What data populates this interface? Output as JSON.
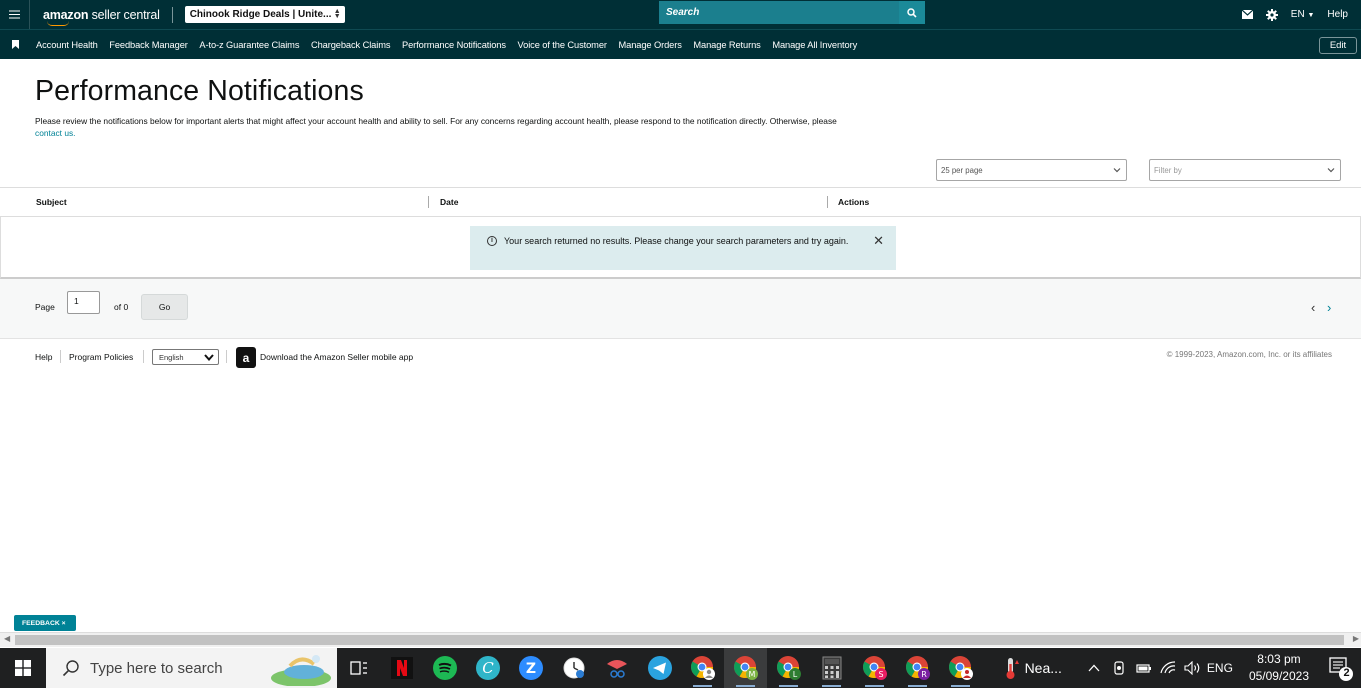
{
  "header": {
    "logo_text_bold": "amazon",
    "logo_text_rest": " seller central",
    "account_selector": "Chinook Ridge Deals | Unite...",
    "search_placeholder": "Search",
    "language": "EN",
    "help_label": "Help"
  },
  "nav": {
    "items": [
      "Account Health",
      "Feedback Manager",
      "A-to-z Guarantee Claims",
      "Chargeback Claims",
      "Performance Notifications",
      "Voice of the Customer",
      "Manage Orders",
      "Manage Returns",
      "Manage All Inventory"
    ],
    "edit_label": "Edit"
  },
  "main": {
    "title": "Performance Notifications",
    "intro": "Please review the notifications below for important alerts that might affect your account health and ability to sell. For any concerns regarding account health, please respond to the notification directly. Otherwise, please",
    "intro_link": "contact us.",
    "per_page": "25 per page",
    "filter_placeholder": "Filter by",
    "columns": [
      "Subject",
      "Date",
      "Actions"
    ],
    "alert_message": "Your search returned no results. Please change your search parameters and try again."
  },
  "pager": {
    "page_label": "Page",
    "page_value": "1",
    "of_label": "of 0",
    "go_label": "Go"
  },
  "footer": {
    "help": "Help",
    "program_policies": "Program Policies",
    "language_select": "English",
    "download_app": "Download the Amazon Seller mobile app",
    "copyright": "© 1999-2023, Amazon.com, Inc. or its affiliates"
  },
  "feedback_tab": "FEEDBACK ×",
  "taskbar": {
    "search_placeholder": "Type here to search",
    "pinned_icons": [
      "task-view-icon",
      "netflix-icon",
      "spotify-icon",
      "canva-icon",
      "zoom-icon",
      "clock-app-icon",
      "snipping-icon",
      "telegram-icon",
      "chrome-icon",
      "chrome-profile-m-icon",
      "chrome-profile-l-icon",
      "calculator-icon",
      "chrome-profile-s-icon",
      "chrome-profile-r-icon",
      "chrome-profile-a-icon"
    ],
    "weather": "Nea...",
    "language": "ENG",
    "time": "8:03 pm",
    "date": "05/09/2023",
    "notification_count": "2"
  }
}
